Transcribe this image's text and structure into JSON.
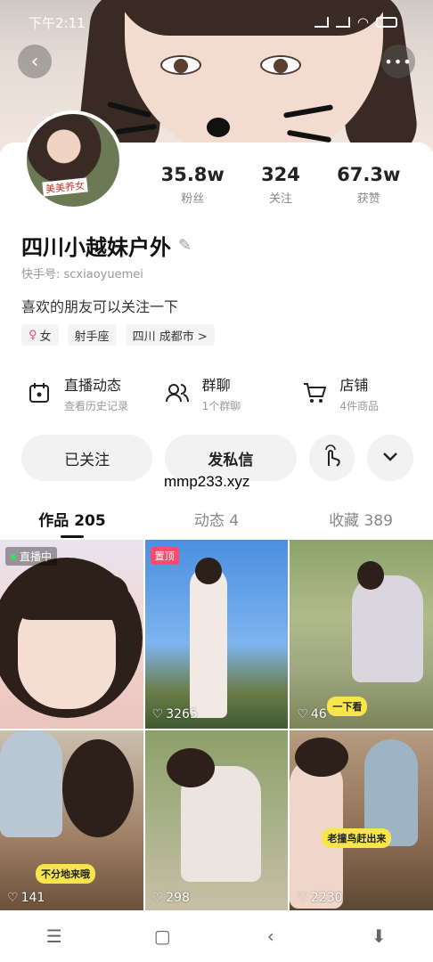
{
  "status_bar": {
    "time": "下午2:11"
  },
  "profile": {
    "avatar_caption": "美美养女",
    "stats": [
      {
        "value": "35.8w",
        "label": "粉丝"
      },
      {
        "value": "324",
        "label": "关注"
      },
      {
        "value": "67.3w",
        "label": "获赞"
      }
    ],
    "name": "四川小越妹户外",
    "uid": "快手号: scxiaoyuemei",
    "bio": "喜欢的朋友可以关注一下",
    "tags": [
      "女",
      "射手座",
      "四川 成都市 >"
    ]
  },
  "features": [
    {
      "icon": "calendar-icon",
      "title": "直播动态",
      "subtitle": "查看历史记录"
    },
    {
      "icon": "group-chat-icon",
      "title": "群聊",
      "subtitle": "1个群聊"
    },
    {
      "icon": "shop-cart-icon",
      "title": "店铺",
      "subtitle": "4件商品"
    }
  ],
  "actions": {
    "followed_label": "已关注",
    "message_label": "发私信"
  },
  "watermark": "mmp233.xyz",
  "tabs": [
    {
      "label": "作品 205",
      "active": true
    },
    {
      "label": "动态 4",
      "active": false
    },
    {
      "label": "收藏 389",
      "active": false
    }
  ],
  "grid": [
    {
      "badge": "直播中",
      "likes": "",
      "sticker": ""
    },
    {
      "badge": "置顶",
      "likes": "3265",
      "sticker": ""
    },
    {
      "badge": "",
      "likes": "46",
      "sticker": "一下看"
    },
    {
      "badge": "",
      "likes": "141",
      "sticker": "不分地来哦"
    },
    {
      "badge": "",
      "likes": "298",
      "sticker": ""
    },
    {
      "badge": "",
      "likes": "2230",
      "sticker": "老撞鸟赶出来"
    }
  ],
  "colors": {
    "accent_pink": "#ff4a6e",
    "live_green": "#3ddc6a",
    "text": "#222222"
  }
}
